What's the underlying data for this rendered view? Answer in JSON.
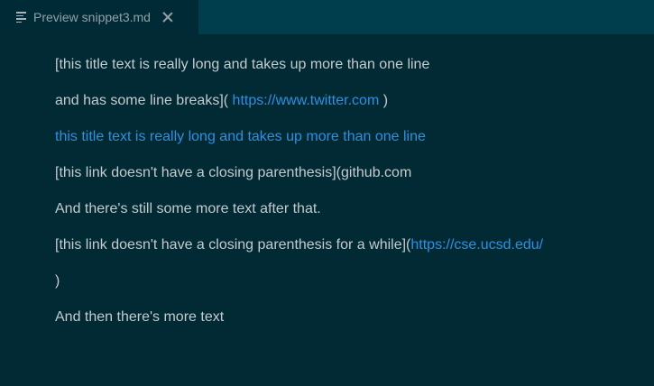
{
  "tab": {
    "icon": "preview-lines-icon",
    "title": "Preview snippet3.md",
    "close_icon": "close-icon"
  },
  "colors": {
    "background": "#012a35",
    "tabbar": "#003e4d",
    "active_tab": "#002b36",
    "text": "#c4cbcd",
    "link": "#2f8fe0"
  },
  "content": {
    "line1": "[this title text is really long and takes up more than one line",
    "line2_text": "and has some line breaks](",
    "line2_link": " https://www.twitter.com ",
    "line2_end": ")",
    "line3_link": "this title text is really long and takes up more than one line",
    "line4": "[this link doesn't have a closing parenthesis](github.com",
    "line5": "And there's still some more text after that.",
    "line6_text": "[this link doesn't have a closing parenthesis for a while](",
    "line6_link": "https://cse.ucsd.edu/",
    "line7": ")",
    "line8": "And then there's more text"
  }
}
